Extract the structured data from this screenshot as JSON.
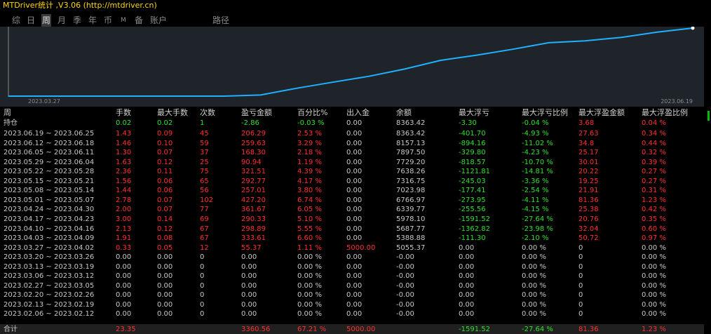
{
  "app": {
    "title": "MTDriver统计 ,V3.06 (http://mtdriver.cn)"
  },
  "tabs": [
    {
      "label": "综",
      "active": false
    },
    {
      "label": "日",
      "active": false
    },
    {
      "label": "周",
      "active": true
    },
    {
      "label": "月",
      "active": false
    },
    {
      "label": "季",
      "active": false
    },
    {
      "label": "年",
      "active": false
    },
    {
      "label": "币",
      "active": false
    },
    {
      "label": "M",
      "active": false
    },
    {
      "label": "备",
      "active": false
    },
    {
      "label": "账户",
      "active": false
    },
    {
      "label": "路径",
      "active": false
    }
  ],
  "colors": {
    "line": "#1fb0ff",
    "profit": "#ff3030",
    "loss": "#30e030",
    "panel": "#1f242b"
  },
  "chart_data": {
    "type": "line",
    "x_start_label": "2023.03.27",
    "x_end_label": "2023.06.19",
    "x": [
      "2023.02.06",
      "2023.02.13",
      "2023.02.20",
      "2023.02.27",
      "2023.03.06",
      "2023.03.13",
      "2023.03.20",
      "2023.03.27",
      "2023.04.03",
      "2023.04.10",
      "2023.04.17",
      "2023.04.24",
      "2023.05.01",
      "2023.05.08",
      "2023.05.15",
      "2023.05.22",
      "2023.05.29",
      "2023.06.05",
      "2023.06.12",
      "2023.06.19"
    ],
    "values": [
      0,
      0,
      0,
      0,
      0,
      0,
      0,
      55.37,
      388.98,
      687.87,
      978.2,
      1339.87,
      1767.07,
      2023.98,
      2316.75,
      2638.26,
      2729.2,
      2897.5,
      3157.13,
      3363.42
    ],
    "ylim": [
      0,
      3363.42
    ]
  },
  "table": {
    "headers": [
      "周",
      "手数",
      "最大手数",
      "次数",
      "盈亏金额",
      "百分比%",
      "出入金",
      "余额",
      "最大浮亏",
      "最大浮亏比例",
      "最大浮盈金额",
      "最大浮盈比例"
    ],
    "hold": {
      "label": "持仓",
      "lots": "0.02",
      "max_lots": "0.02",
      "count": "1",
      "pnl": "-2.86",
      "pct": "-0.03 %",
      "flow": "0.00",
      "balance": "8363.42",
      "max_loss": "-3.30",
      "max_loss_pct": "-0.04 %",
      "max_profit": "3.68",
      "max_profit_pct": "0.04 %"
    },
    "rows": [
      {
        "label": "2023.06.19 ~ 2023.06.25",
        "lots": "1.43",
        "max_lots": "0.09",
        "count": "45",
        "pnl": "206.29",
        "pct": "2.53 %",
        "flow": "0.00",
        "balance": "8363.42",
        "max_loss": "-401.70",
        "max_loss_pct": "-4.93 %",
        "max_profit": "27.63",
        "max_profit_pct": "0.34 %"
      },
      {
        "label": "2023.06.12 ~ 2023.06.18",
        "lots": "1.46",
        "max_lots": "0.10",
        "count": "59",
        "pnl": "259.63",
        "pct": "3.29 %",
        "flow": "0.00",
        "balance": "8157.13",
        "max_loss": "-894.16",
        "max_loss_pct": "-11.02 %",
        "max_profit": "34.8",
        "max_profit_pct": "0.44 %"
      },
      {
        "label": "2023.06.05 ~ 2023.06.11",
        "lots": "1.30",
        "max_lots": "0.07",
        "count": "37",
        "pnl": "168.30",
        "pct": "2.18 %",
        "flow": "0.00",
        "balance": "7897.50",
        "max_loss": "-329.80",
        "max_loss_pct": "-4.23 %",
        "max_profit": "25.17",
        "max_profit_pct": "0.32 %"
      },
      {
        "label": "2023.05.29 ~ 2023.06.04",
        "lots": "1.63",
        "max_lots": "0.12",
        "count": "25",
        "pnl": "90.94",
        "pct": "1.19 %",
        "flow": "0.00",
        "balance": "7729.20",
        "max_loss": "-818.57",
        "max_loss_pct": "-10.70 %",
        "max_profit": "30.01",
        "max_profit_pct": "0.39 %"
      },
      {
        "label": "2023.05.22 ~ 2023.05.28",
        "lots": "2.36",
        "max_lots": "0.11",
        "count": "75",
        "pnl": "321.51",
        "pct": "4.39 %",
        "flow": "0.00",
        "balance": "7638.26",
        "max_loss": "-1121.81",
        "max_loss_pct": "-14.81 %",
        "max_profit": "20.22",
        "max_profit_pct": "0.27 %"
      },
      {
        "label": "2023.05.15 ~ 2023.05.21",
        "lots": "1.56",
        "max_lots": "0.06",
        "count": "65",
        "pnl": "292.77",
        "pct": "4.17 %",
        "flow": "0.00",
        "balance": "7316.75",
        "max_loss": "-245.03",
        "max_loss_pct": "-3.36 %",
        "max_profit": "19.25",
        "max_profit_pct": "0.27 %"
      },
      {
        "label": "2023.05.08 ~ 2023.05.14",
        "lots": "1.44",
        "max_lots": "0.06",
        "count": "56",
        "pnl": "257.01",
        "pct": "3.80 %",
        "flow": "0.00",
        "balance": "7023.98",
        "max_loss": "-177.41",
        "max_loss_pct": "-2.54 %",
        "max_profit": "21.91",
        "max_profit_pct": "0.31 %"
      },
      {
        "label": "2023.05.01 ~ 2023.05.07",
        "lots": "2.78",
        "max_lots": "0.07",
        "count": "102",
        "pnl": "427.20",
        "pct": "6.74 %",
        "flow": "0.00",
        "balance": "6766.97",
        "max_loss": "-273.95",
        "max_loss_pct": "-4.11 %",
        "max_profit": "81.36",
        "max_profit_pct": "1.23 %"
      },
      {
        "label": "2023.04.24 ~ 2023.04.30",
        "lots": "2.00",
        "max_lots": "0.07",
        "count": "77",
        "pnl": "361.67",
        "pct": "6.05 %",
        "flow": "0.00",
        "balance": "6339.77",
        "max_loss": "-255.56",
        "max_loss_pct": "-4.15 %",
        "max_profit": "25.38",
        "max_profit_pct": "0.42 %"
      },
      {
        "label": "2023.04.17 ~ 2023.04.23",
        "lots": "3.00",
        "max_lots": "0.14",
        "count": "69",
        "pnl": "290.33",
        "pct": "5.10 %",
        "flow": "0.00",
        "balance": "5978.10",
        "max_loss": "-1591.52",
        "max_loss_pct": "-27.64 %",
        "max_profit": "20.76",
        "max_profit_pct": "0.35 %"
      },
      {
        "label": "2023.04.10 ~ 2023.04.16",
        "lots": "2.13",
        "max_lots": "0.12",
        "count": "67",
        "pnl": "298.89",
        "pct": "5.55 %",
        "flow": "0.00",
        "balance": "5687.77",
        "max_loss": "-1362.82",
        "max_loss_pct": "-23.98 %",
        "max_profit": "32.04",
        "max_profit_pct": "0.60 %"
      },
      {
        "label": "2023.04.03 ~ 2023.04.09",
        "lots": "1.91",
        "max_lots": "0.08",
        "count": "67",
        "pnl": "333.61",
        "pct": "6.60 %",
        "flow": "0.00",
        "balance": "5388.88",
        "max_loss": "-111.30",
        "max_loss_pct": "-2.10 %",
        "max_profit": "50.72",
        "max_profit_pct": "0.97 %"
      },
      {
        "label": "2023.03.27 ~ 2023.04.02",
        "lots": "0.33",
        "max_lots": "0.05",
        "count": "12",
        "pnl": "55.37",
        "pct": "1.11 %",
        "flow": "5000.00",
        "balance": "5055.37",
        "max_loss": "0.00",
        "max_loss_pct": "0.00 %",
        "max_profit": "0",
        "max_profit_pct": "0.00 %"
      },
      {
        "label": "2023.03.20 ~ 2023.03.26",
        "lots": "0.00",
        "max_lots": "0.00",
        "count": "0",
        "pnl": "0.00",
        "pct": "0.00 %",
        "flow": "0.00",
        "balance": "-0.00",
        "max_loss": "0.00",
        "max_loss_pct": "0.00 %",
        "max_profit": "0",
        "max_profit_pct": "0.00 %"
      },
      {
        "label": "2023.03.13 ~ 2023.03.19",
        "lots": "0.00",
        "max_lots": "0.00",
        "count": "0",
        "pnl": "0.00",
        "pct": "0.00 %",
        "flow": "0.00",
        "balance": "-0.00",
        "max_loss": "0.00",
        "max_loss_pct": "0.00 %",
        "max_profit": "0",
        "max_profit_pct": "0.00 %"
      },
      {
        "label": "2023.03.06 ~ 2023.03.12",
        "lots": "0.00",
        "max_lots": "0.00",
        "count": "0",
        "pnl": "0.00",
        "pct": "0.00 %",
        "flow": "0.00",
        "balance": "-0.00",
        "max_loss": "0.00",
        "max_loss_pct": "0.00 %",
        "max_profit": "0",
        "max_profit_pct": "0.00 %"
      },
      {
        "label": "2023.02.27 ~ 2023.03.05",
        "lots": "0.00",
        "max_lots": "0.00",
        "count": "0",
        "pnl": "0.00",
        "pct": "0.00 %",
        "flow": "0.00",
        "balance": "-0.00",
        "max_loss": "0.00",
        "max_loss_pct": "0.00 %",
        "max_profit": "0",
        "max_profit_pct": "0.00 %"
      },
      {
        "label": "2023.02.20 ~ 2023.02.26",
        "lots": "0.00",
        "max_lots": "0.00",
        "count": "0",
        "pnl": "0.00",
        "pct": "0.00 %",
        "flow": "0.00",
        "balance": "-0.00",
        "max_loss": "0.00",
        "max_loss_pct": "0.00 %",
        "max_profit": "0",
        "max_profit_pct": "0.00 %"
      },
      {
        "label": "2023.02.13 ~ 2023.02.19",
        "lots": "0.00",
        "max_lots": "0.00",
        "count": "0",
        "pnl": "0.00",
        "pct": "0.00 %",
        "flow": "0.00",
        "balance": "-0.00",
        "max_loss": "0.00",
        "max_loss_pct": "0.00 %",
        "max_profit": "0",
        "max_profit_pct": "0.00 %"
      },
      {
        "label": "2023.02.06 ~ 2023.02.12",
        "lots": "0.00",
        "max_lots": "0.00",
        "count": "0",
        "pnl": "0.00",
        "pct": "0.00 %",
        "flow": "0.00",
        "balance": "-0.00",
        "max_loss": "0.00",
        "max_loss_pct": "0.00 %",
        "max_profit": "0",
        "max_profit_pct": "0.00 %"
      }
    ],
    "total": {
      "label": "合计",
      "lots": "23.35",
      "max_lots": "",
      "count": "",
      "pnl": "3360.56",
      "pct": "67.21 %",
      "flow": "5000.00",
      "balance": "",
      "max_loss": "-1591.52",
      "max_loss_pct": "-27.64 %",
      "max_profit": "81.36",
      "max_profit_pct": "1.23 %"
    }
  }
}
